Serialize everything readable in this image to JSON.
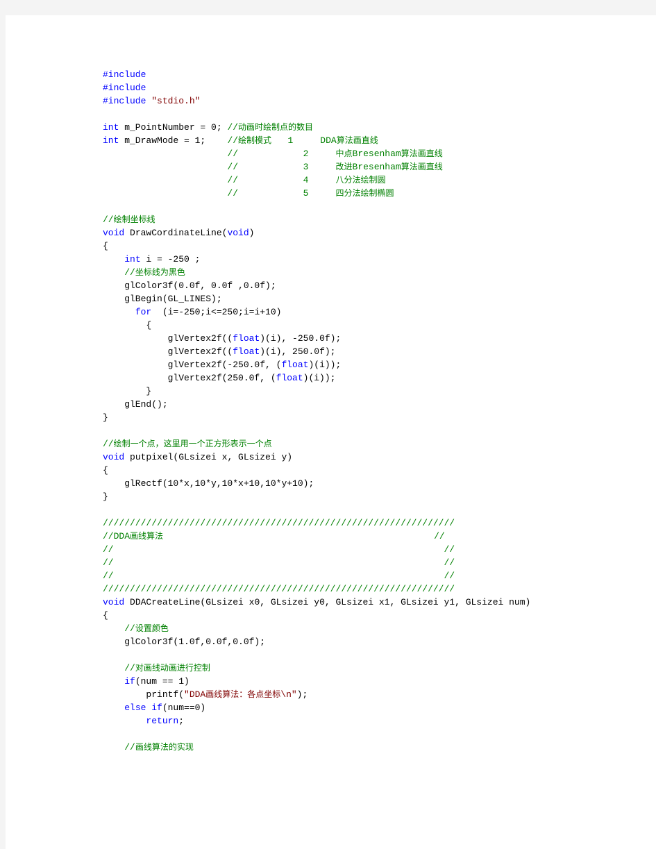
{
  "document": {
    "type": "code-listing",
    "language": "C++ / OpenGL",
    "page_background": "#ffffff",
    "chrome_color": "#f4f4f4",
    "colors": {
      "keyword": "#0000ff",
      "comment": "#008000",
      "string": "#800000",
      "plain": "#000000"
    }
  },
  "code": {
    "lines": [
      {
        "id": "l001",
        "segments": [
          {
            "t": "#include",
            "c": "kw"
          }
        ]
      },
      {
        "id": "l002",
        "segments": [
          {
            "t": "#include",
            "c": "kw"
          }
        ]
      },
      {
        "id": "l003",
        "segments": [
          {
            "t": "#include ",
            "c": "kw"
          },
          {
            "t": "\"stdio.h\"",
            "c": "str"
          }
        ]
      },
      {
        "id": "l004",
        "segments": []
      },
      {
        "id": "l005",
        "segments": [
          {
            "t": "int",
            "c": "kw"
          },
          {
            "t": " m_PointNumber = 0; ",
            "c": "pl"
          },
          {
            "t": "//动画时绘制点的数目",
            "c": "cm"
          }
        ]
      },
      {
        "id": "l006",
        "segments": [
          {
            "t": "int",
            "c": "kw"
          },
          {
            "t": " m_DrawMode = 1;    ",
            "c": "pl"
          },
          {
            "t": "//绘制模式   1     DDA算法画直线",
            "c": "cm"
          }
        ]
      },
      {
        "id": "l007",
        "segments": [
          {
            "t": "                       //            2     中点Bresenham算法画直线",
            "c": "cm"
          }
        ]
      },
      {
        "id": "l008",
        "segments": [
          {
            "t": "                       //            3     改进Bresenham算法画直线",
            "c": "cm"
          }
        ]
      },
      {
        "id": "l009",
        "segments": [
          {
            "t": "                       //            4     八分法绘制圆",
            "c": "cm"
          }
        ]
      },
      {
        "id": "l010",
        "segments": [
          {
            "t": "                       //            5     四分法绘制椭圆",
            "c": "cm"
          }
        ]
      },
      {
        "id": "l011",
        "segments": []
      },
      {
        "id": "l012",
        "segments": [
          {
            "t": "//绘制坐标线",
            "c": "cm"
          }
        ]
      },
      {
        "id": "l013",
        "segments": [
          {
            "t": "void",
            "c": "kw"
          },
          {
            "t": " DrawCordinateLine(",
            "c": "pl"
          },
          {
            "t": "void",
            "c": "kw"
          },
          {
            "t": ")",
            "c": "pl"
          }
        ]
      },
      {
        "id": "l014",
        "segments": [
          {
            "t": "{",
            "c": "pl"
          }
        ]
      },
      {
        "id": "l015",
        "segments": [
          {
            "t": "    ",
            "c": "pl"
          },
          {
            "t": "int",
            "c": "kw"
          },
          {
            "t": " i = -250 ;",
            "c": "pl"
          }
        ]
      },
      {
        "id": "l016",
        "segments": [
          {
            "t": "    ",
            "c": "pl"
          },
          {
            "t": "//坐标线为黑色",
            "c": "cm"
          }
        ]
      },
      {
        "id": "l017",
        "segments": [
          {
            "t": "    glColor3f(0.0f, 0.0f ,0.0f);",
            "c": "pl"
          }
        ]
      },
      {
        "id": "l018",
        "segments": [
          {
            "t": "    glBegin(GL_LINES);",
            "c": "pl"
          }
        ]
      },
      {
        "id": "l019",
        "segments": [
          {
            "t": "      ",
            "c": "pl"
          },
          {
            "t": "for",
            "c": "kw"
          },
          {
            "t": "  (i=-250;i<=250;i=i+10)",
            "c": "pl"
          }
        ]
      },
      {
        "id": "l020",
        "segments": [
          {
            "t": "        {",
            "c": "pl"
          }
        ]
      },
      {
        "id": "l021",
        "segments": [
          {
            "t": "            glVertex2f((",
            "c": "pl"
          },
          {
            "t": "float",
            "c": "kw"
          },
          {
            "t": ")(i), -250.0f);",
            "c": "pl"
          }
        ]
      },
      {
        "id": "l022",
        "segments": [
          {
            "t": "            glVertex2f((",
            "c": "pl"
          },
          {
            "t": "float",
            "c": "kw"
          },
          {
            "t": ")(i), 250.0f);",
            "c": "pl"
          }
        ]
      },
      {
        "id": "l023",
        "segments": [
          {
            "t": "            glVertex2f(-250.0f, (",
            "c": "pl"
          },
          {
            "t": "float",
            "c": "kw"
          },
          {
            "t": ")(i));",
            "c": "pl"
          }
        ]
      },
      {
        "id": "l024",
        "segments": [
          {
            "t": "            glVertex2f(250.0f, (",
            "c": "pl"
          },
          {
            "t": "float",
            "c": "kw"
          },
          {
            "t": ")(i));",
            "c": "pl"
          }
        ]
      },
      {
        "id": "l025",
        "segments": [
          {
            "t": "        }",
            "c": "pl"
          }
        ]
      },
      {
        "id": "l026",
        "segments": [
          {
            "t": "    glEnd();",
            "c": "pl"
          }
        ]
      },
      {
        "id": "l027",
        "segments": [
          {
            "t": "}",
            "c": "pl"
          }
        ]
      },
      {
        "id": "l028",
        "segments": []
      },
      {
        "id": "l029",
        "segments": [
          {
            "t": "//绘制一个点，这里用一个正方形表示一个点",
            "c": "cm"
          }
        ]
      },
      {
        "id": "l030",
        "segments": [
          {
            "t": "void",
            "c": "kw"
          },
          {
            "t": " putpixel(GLsizei x, GLsizei y)",
            "c": "pl"
          }
        ]
      },
      {
        "id": "l031",
        "segments": [
          {
            "t": "{",
            "c": "pl"
          }
        ]
      },
      {
        "id": "l032",
        "segments": [
          {
            "t": "    glRectf(10*x,10*y,10*x+10,10*y+10);",
            "c": "pl"
          }
        ]
      },
      {
        "id": "l033",
        "segments": [
          {
            "t": "}",
            "c": "pl"
          }
        ]
      },
      {
        "id": "l034",
        "segments": []
      },
      {
        "id": "l035",
        "segments": [
          {
            "t": "/////////////////////////////////////////////////////////////////",
            "c": "cm"
          }
        ]
      },
      {
        "id": "l036",
        "segments": [
          {
            "t": "//DDA画线算法                                                  //",
            "c": "cm"
          }
        ]
      },
      {
        "id": "l037",
        "segments": [
          {
            "t": "//                                                             //",
            "c": "cm"
          }
        ]
      },
      {
        "id": "l038",
        "segments": [
          {
            "t": "//                                                             //",
            "c": "cm"
          }
        ]
      },
      {
        "id": "l039",
        "segments": [
          {
            "t": "//                                                             //",
            "c": "cm"
          }
        ]
      },
      {
        "id": "l040",
        "segments": [
          {
            "t": "/////////////////////////////////////////////////////////////////",
            "c": "cm"
          }
        ]
      },
      {
        "id": "l041",
        "segments": [
          {
            "t": "void",
            "c": "kw"
          },
          {
            "t": " DDACreateLine(GLsizei x0, GLsizei y0, GLsizei x1, GLsizei y1, GLsizei num)",
            "c": "pl"
          }
        ]
      },
      {
        "id": "l042",
        "segments": [
          {
            "t": "{",
            "c": "pl"
          }
        ]
      },
      {
        "id": "l043",
        "segments": [
          {
            "t": "    ",
            "c": "pl"
          },
          {
            "t": "//设置颜色",
            "c": "cm"
          }
        ]
      },
      {
        "id": "l044",
        "segments": [
          {
            "t": "    glColor3f(1.0f,0.0f,0.0f);",
            "c": "pl"
          }
        ]
      },
      {
        "id": "l045",
        "segments": []
      },
      {
        "id": "l046",
        "segments": [
          {
            "t": "    ",
            "c": "pl"
          },
          {
            "t": "//对画线动画进行控制",
            "c": "cm"
          }
        ]
      },
      {
        "id": "l047",
        "segments": [
          {
            "t": "    ",
            "c": "pl"
          },
          {
            "t": "if",
            "c": "kw"
          },
          {
            "t": "(num == 1)",
            "c": "pl"
          }
        ]
      },
      {
        "id": "l048",
        "segments": [
          {
            "t": "        printf(",
            "c": "pl"
          },
          {
            "t": "\"DDA画线算法：各点坐标\\n\"",
            "c": "str"
          },
          {
            "t": ");",
            "c": "pl"
          }
        ]
      },
      {
        "id": "l049",
        "segments": [
          {
            "t": "    ",
            "c": "pl"
          },
          {
            "t": "else if",
            "c": "kw"
          },
          {
            "t": "(num==0)",
            "c": "pl"
          }
        ]
      },
      {
        "id": "l050",
        "segments": [
          {
            "t": "        ",
            "c": "pl"
          },
          {
            "t": "return",
            "c": "kw"
          },
          {
            "t": ";",
            "c": "pl"
          }
        ]
      },
      {
        "id": "l051",
        "segments": []
      },
      {
        "id": "l052",
        "segments": [
          {
            "t": "    ",
            "c": "pl"
          },
          {
            "t": "//画线算法的实现",
            "c": "cm"
          }
        ]
      }
    ]
  }
}
